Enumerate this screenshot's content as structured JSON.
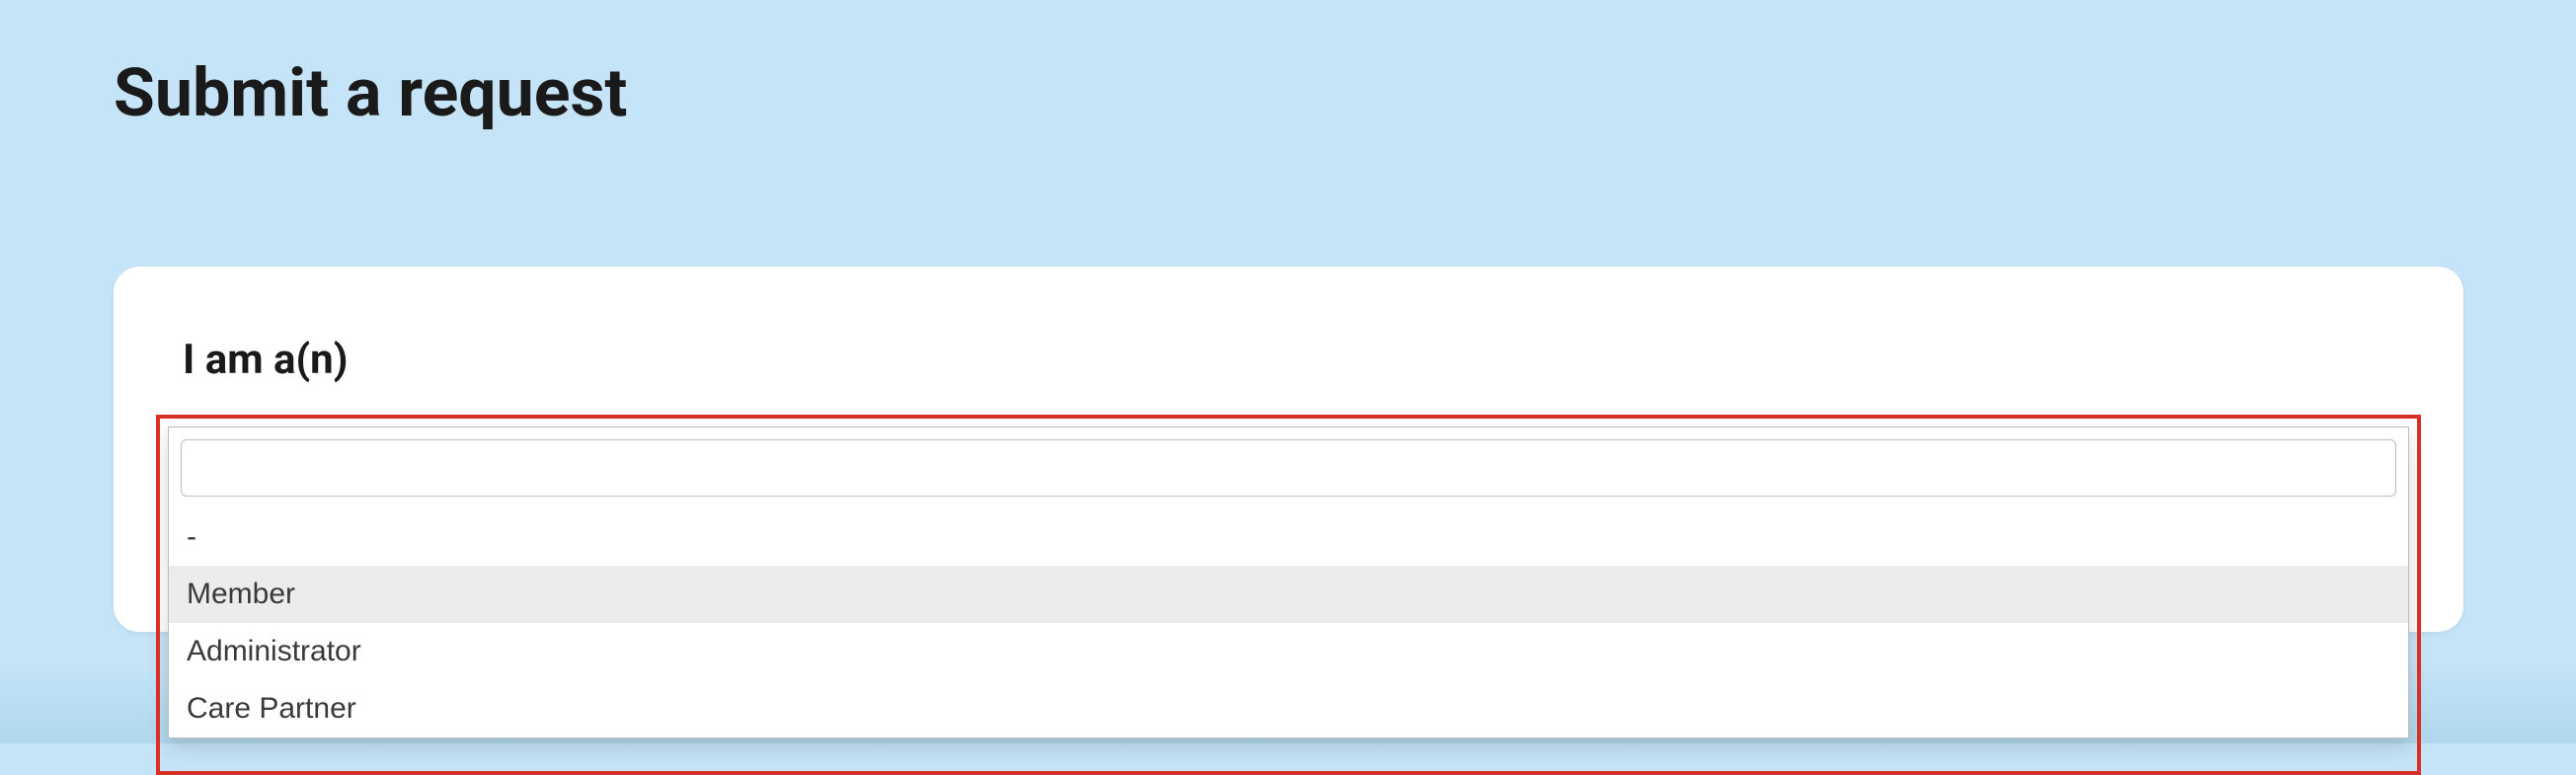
{
  "page": {
    "title": "Submit a request"
  },
  "form": {
    "role_field": {
      "label": "I am a(n)",
      "search_value": "",
      "options": [
        {
          "label": "-",
          "highlighted": false
        },
        {
          "label": "Member",
          "highlighted": true
        },
        {
          "label": "Administrator",
          "highlighted": false
        },
        {
          "label": "Care Partner",
          "highlighted": false
        }
      ]
    }
  }
}
